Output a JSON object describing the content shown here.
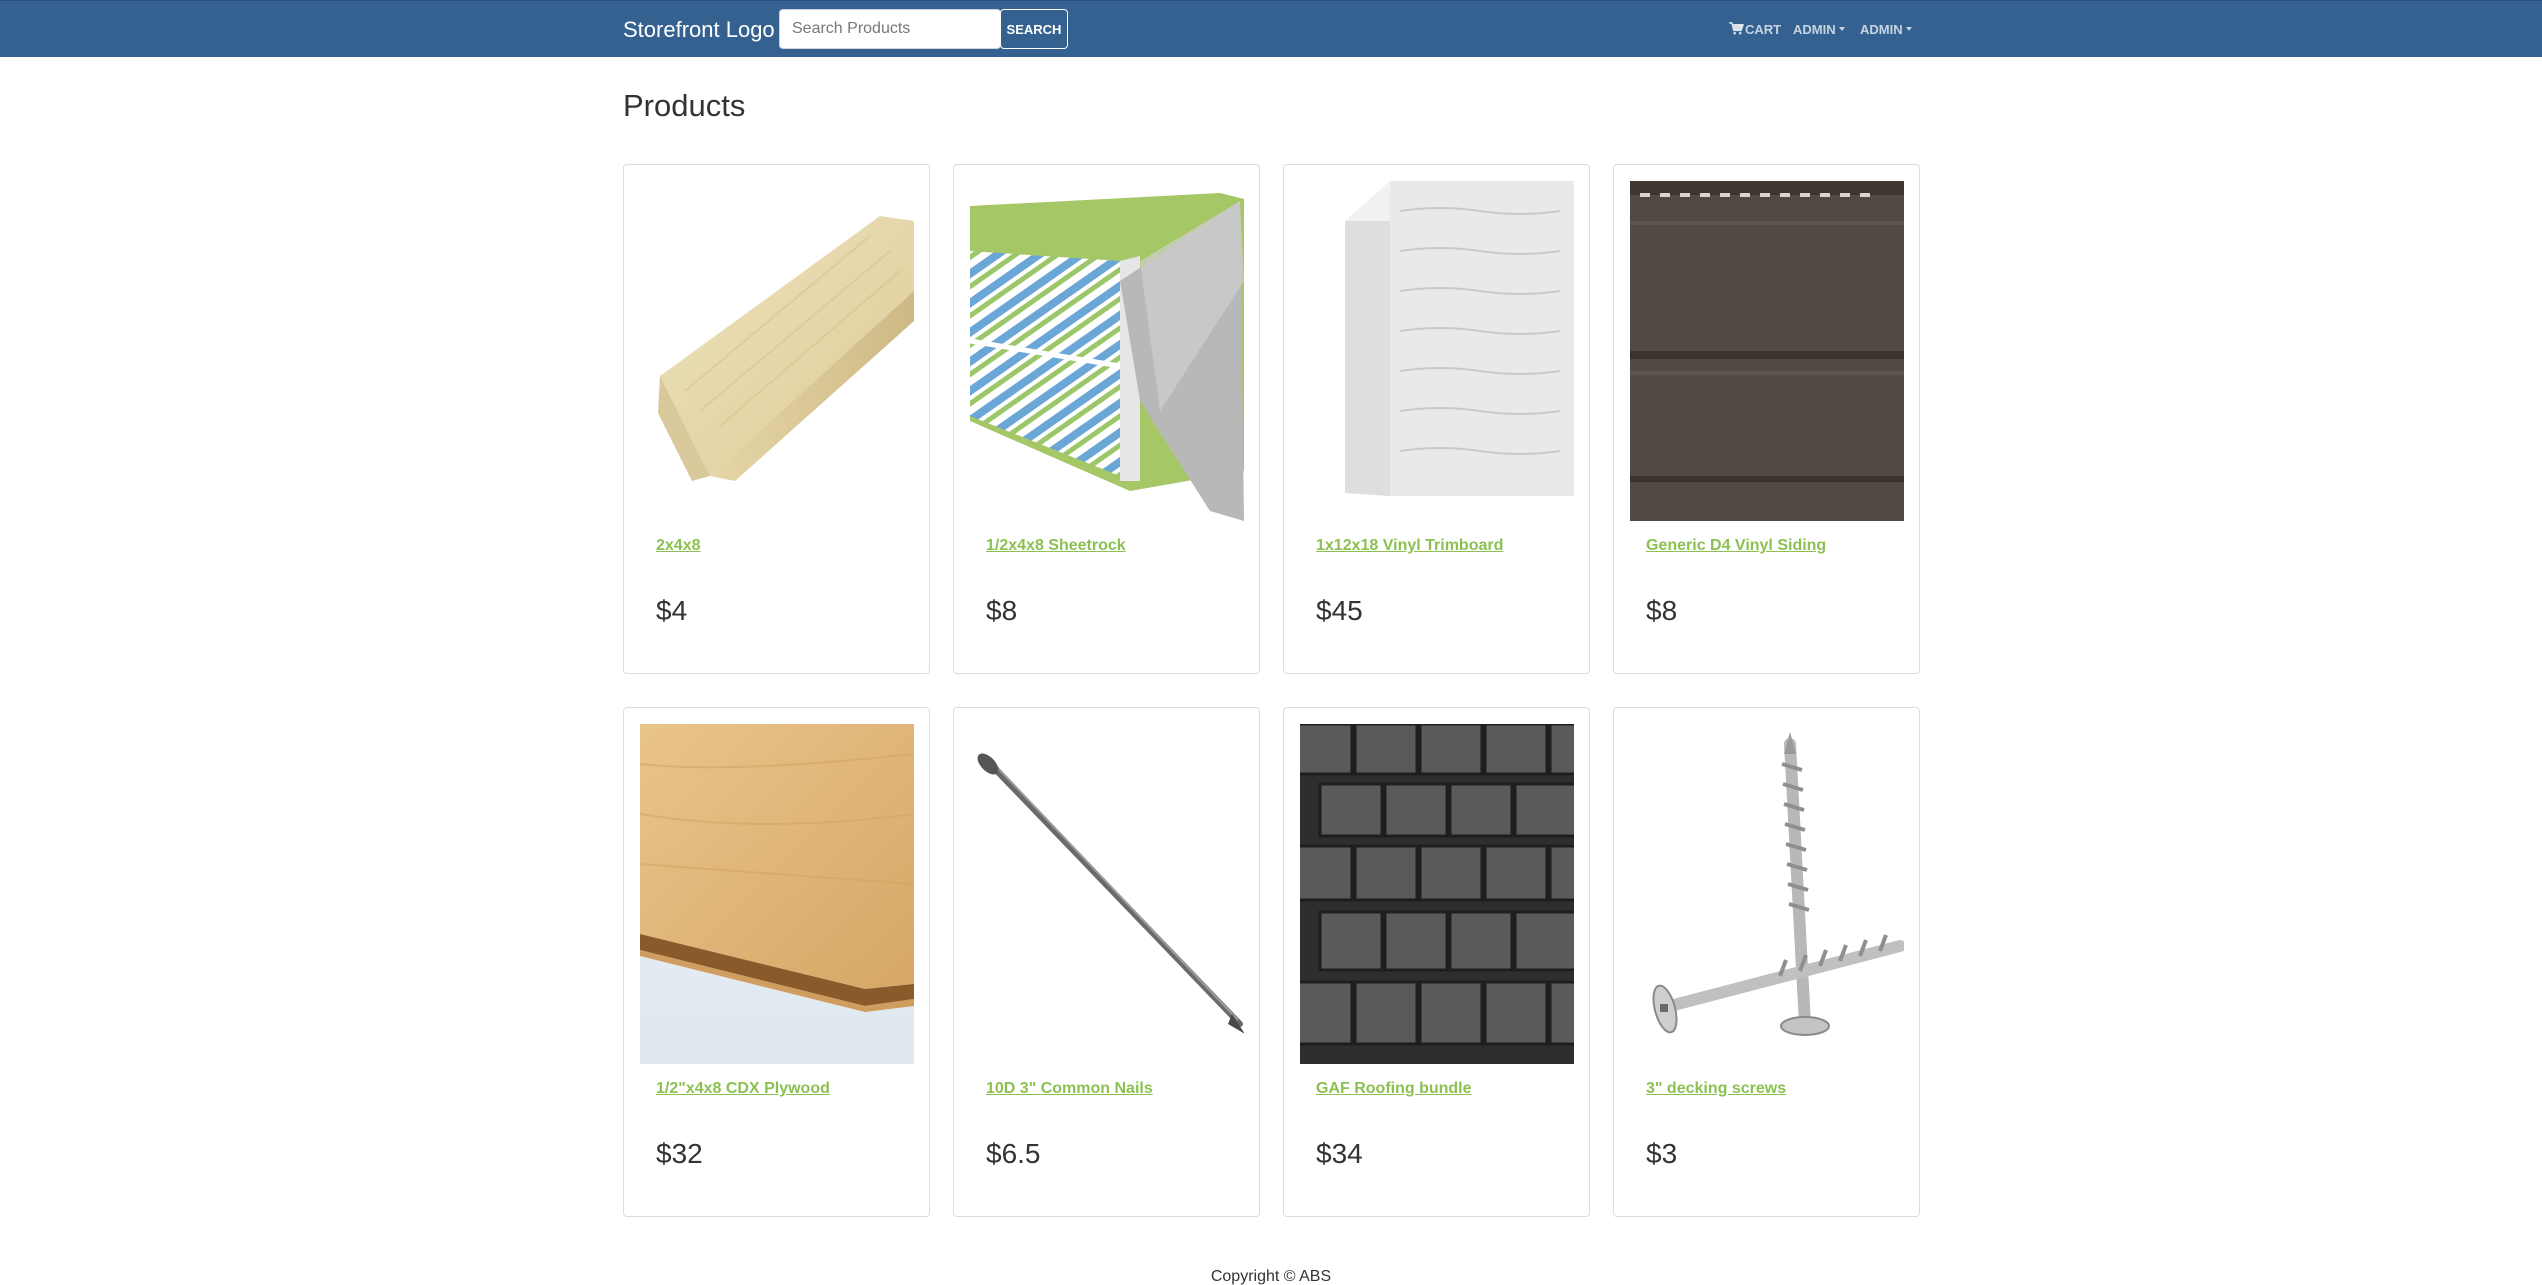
{
  "navbar": {
    "brand": "Storefront Logo",
    "search_placeholder": "Search Products",
    "search_value": "",
    "search_button": "SEARCH",
    "cart_label": "CART",
    "cart_icon": "shopping-cart-icon",
    "admin_menu_1": "ADMIN",
    "admin_menu_2": "ADMIN"
  },
  "main": {
    "title": "Products",
    "products": [
      {
        "name": "2x4x8",
        "price": "$4",
        "image": "lumber-2x4-image"
      },
      {
        "name": "1/2x4x8 Sheetrock",
        "price": "$8",
        "image": "sheetrock-image"
      },
      {
        "name": "1x12x18 Vinyl Trimboard",
        "price": "$45",
        "image": "vinyl-trimboard-image"
      },
      {
        "name": "Generic D4 Vinyl Siding",
        "price": "$8",
        "image": "vinyl-siding-image"
      },
      {
        "name": "1/2\"x4x8 CDX Plywood",
        "price": "$32",
        "image": "plywood-image"
      },
      {
        "name": "10D 3\" Common Nails",
        "price": "$6.5",
        "image": "nail-image"
      },
      {
        "name": "GAF Roofing bundle",
        "price": "$34",
        "image": "roofing-shingles-image"
      },
      {
        "name": "3\" decking screws",
        "price": "$3",
        "image": "decking-screws-image"
      }
    ]
  },
  "footer": {
    "copyright": "Copyright © ABS"
  },
  "colors": {
    "navbar": "#34618f",
    "link_green": "#8cc152",
    "card_border": "#dcdcdc"
  }
}
